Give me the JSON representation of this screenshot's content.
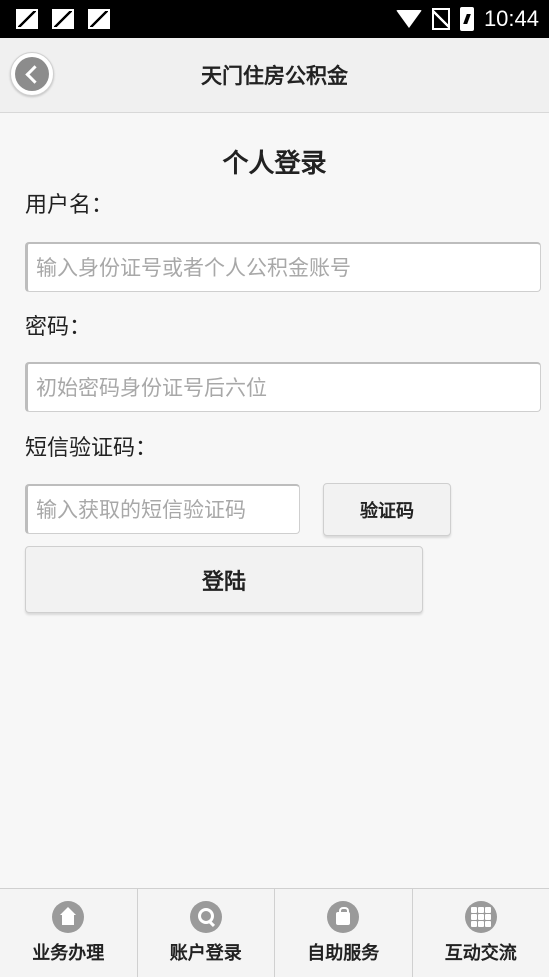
{
  "status_bar": {
    "time": "10:44"
  },
  "header": {
    "title": "天门住房公积金"
  },
  "form": {
    "title": "个人登录",
    "username_label": "用户名：",
    "username_placeholder": "输入身份证号或者个人公积金账号",
    "password_label": "密码：",
    "password_placeholder": "初始密码身份证号后六位",
    "sms_label": "短信验证码：",
    "sms_placeholder": "输入获取的短信验证码",
    "sms_button": "验证码",
    "login_button": "登陆"
  },
  "tabbar": {
    "items": [
      {
        "label": "业务办理",
        "icon": "home-icon"
      },
      {
        "label": "账户登录",
        "icon": "search-icon"
      },
      {
        "label": "自助服务",
        "icon": "bag-icon"
      },
      {
        "label": "互动交流",
        "icon": "grid-icon"
      }
    ]
  }
}
